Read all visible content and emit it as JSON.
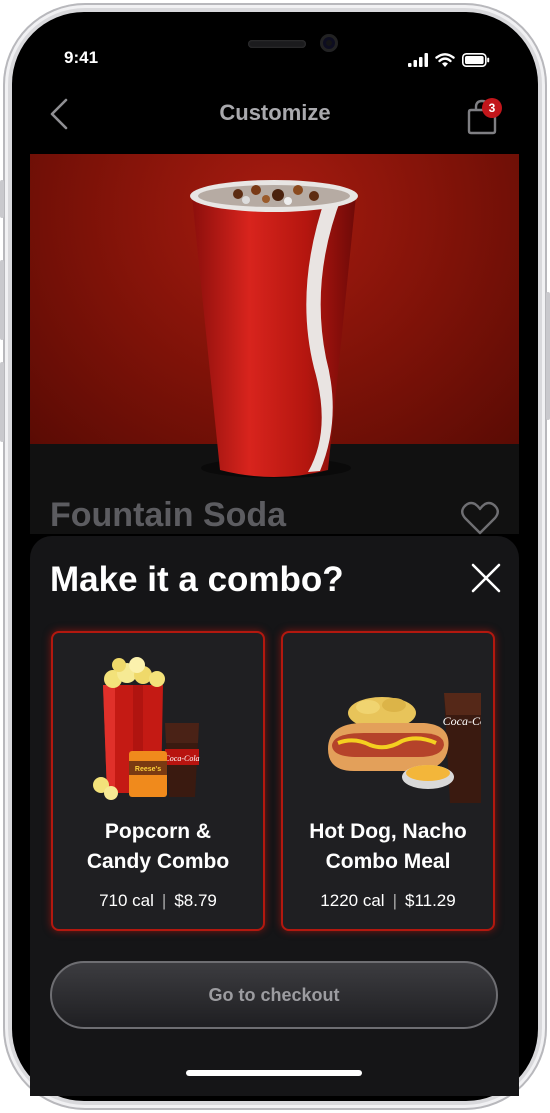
{
  "status_bar": {
    "time": "9:41"
  },
  "nav": {
    "title": "Customize",
    "cart_count": "3"
  },
  "product": {
    "name": "Fountain Soda"
  },
  "combo_sheet": {
    "title": "Make it a combo?",
    "options": [
      {
        "title_line1": "Popcorn &",
        "title_line2": "Candy Combo",
        "calories": "710 cal",
        "separator": "|",
        "price": "$8.79"
      },
      {
        "title_line1": "Hot Dog, Nacho",
        "title_line2": "Combo Meal",
        "calories": "1220 cal",
        "separator": "|",
        "price": "$11.29"
      }
    ],
    "checkout_label": "Go to checkout",
    "cola_logo_text": "Coca-Cola",
    "candy_logo_text": "Reese's"
  },
  "colors": {
    "accent_red": "#c2161b",
    "sheet_bg": "#151517",
    "card_border": "#b3180f"
  },
  "icons": [
    "back-chevron-icon",
    "shopping-bag-icon",
    "heart-icon",
    "close-icon",
    "signal-icon",
    "wifi-icon",
    "battery-icon"
  ]
}
